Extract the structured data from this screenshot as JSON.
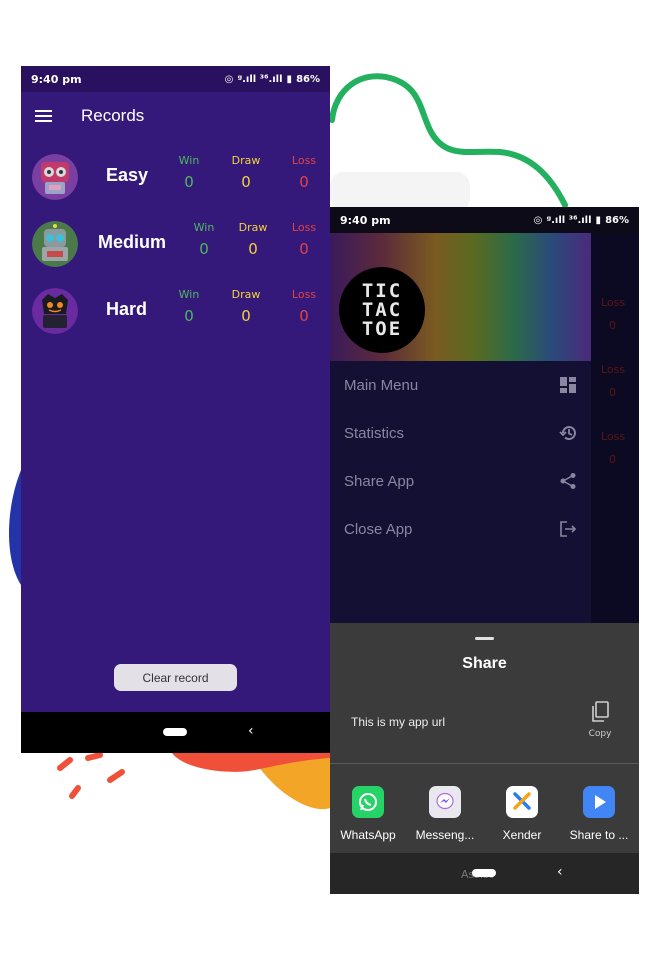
{
  "left_phone": {
    "status": {
      "time": "9:40 pm",
      "signal": "ᵍ.ıll ³⁶.ıll",
      "battery": "86%"
    },
    "app_bar": {
      "title": "Records"
    },
    "columns": {
      "win": "Win",
      "draw": "Draw",
      "loss": "Loss"
    },
    "records": [
      {
        "level": "Easy",
        "win": "0",
        "draw": "0",
        "loss": "0"
      },
      {
        "level": "Medium",
        "win": "0",
        "draw": "0",
        "loss": "0"
      },
      {
        "level": "Hard",
        "win": "0",
        "draw": "0",
        "loss": "0"
      }
    ],
    "clear_button": "Clear record",
    "nav_back": "‹"
  },
  "right_phone": {
    "status": {
      "time": "9:40 pm",
      "signal": "ᵍ.ıll ³⁶.ıll",
      "battery": "86%"
    },
    "logo": [
      "TIC",
      "TAC",
      "TOE"
    ],
    "drawer_items": [
      {
        "label": "Main Menu",
        "icon": "dashboard-icon"
      },
      {
        "label": "Statistics",
        "icon": "history-icon"
      },
      {
        "label": "Share App",
        "icon": "share-icon"
      },
      {
        "label": "Close App",
        "icon": "exit-icon"
      }
    ],
    "peek": {
      "loss": "Loss",
      "zero": "0"
    },
    "share_sheet": {
      "title": "Share",
      "text": "This is my app url",
      "copy_label": "Copy",
      "apps": [
        {
          "name": "WhatsApp",
          "color": "#25d366"
        },
        {
          "name": "Messeng...",
          "color": "#e8e8ee"
        },
        {
          "name": "Xender",
          "color": "#ffffff"
        },
        {
          "name": "Share to ...",
          "color": "#4285f4"
        }
      ]
    },
    "nav": {
      "assist": "Assist",
      "back": "‹"
    }
  },
  "colors": {
    "win": "#4fb85e",
    "draw": "#f2d23b",
    "loss": "#e04444",
    "app_bg": "#34197a"
  }
}
